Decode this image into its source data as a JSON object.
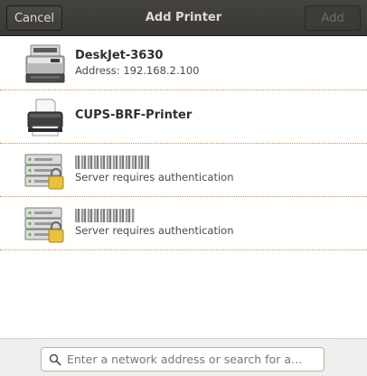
{
  "header": {
    "cancel_label": "Cancel",
    "title": "Add Printer",
    "add_label": "Add"
  },
  "printers": [
    {
      "name": "DeskJet-3630",
      "detail": "Address: 192.168.2.100",
      "icon": "laser-printer-icon"
    },
    {
      "name": "CUPS-BRF-Printer",
      "detail": "",
      "icon": "printer-icon"
    },
    {
      "name": "",
      "detail": "Server requires authentication",
      "icon": "locked-server-icon"
    },
    {
      "name": "",
      "detail": "Server requires authentication",
      "icon": "locked-server-icon"
    }
  ],
  "search": {
    "placeholder": "Enter a network address or search for a…",
    "value": ""
  },
  "colors": {
    "headerbar": "#3e3d3a",
    "separator": "#e2894c",
    "footer": "#f0efed"
  }
}
